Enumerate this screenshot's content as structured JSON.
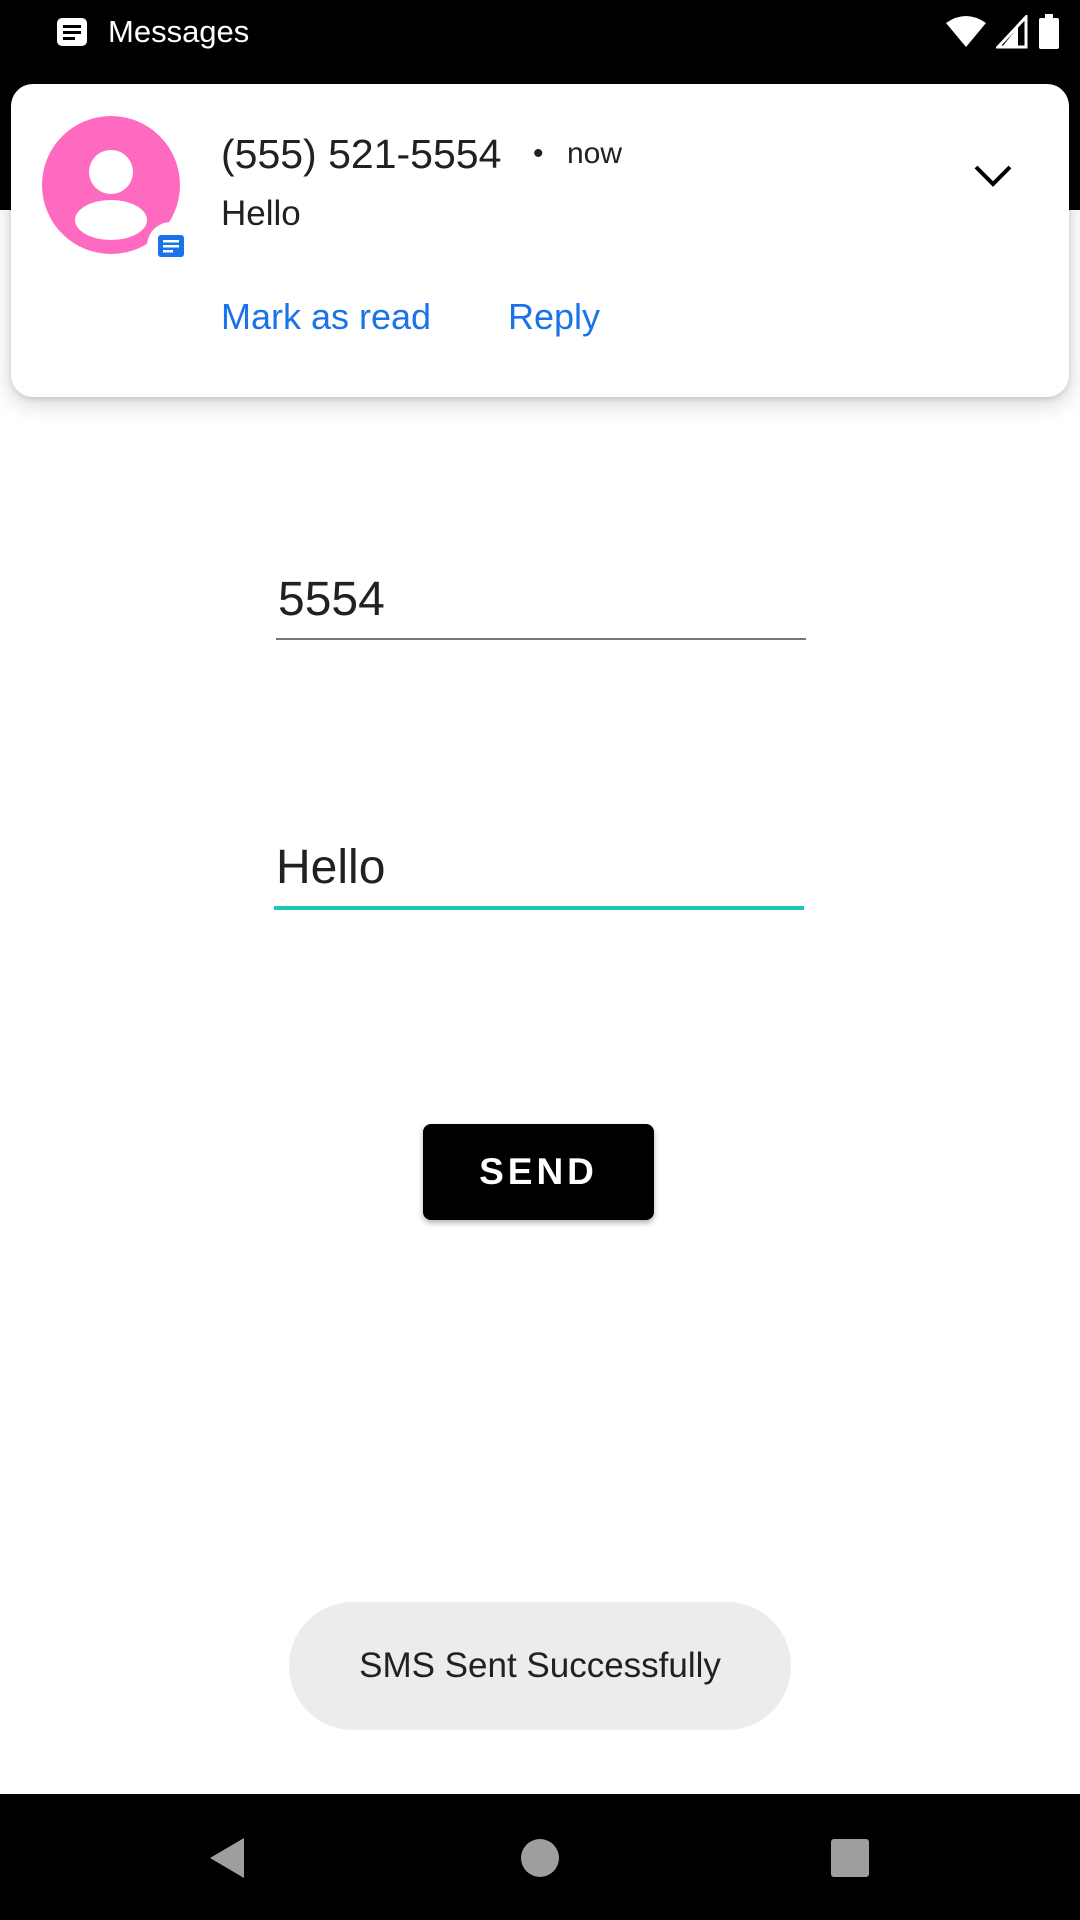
{
  "status_bar": {
    "app_name": "Messages",
    "icons": [
      "messages-icon",
      "wifi-icon",
      "signal-icon",
      "battery-icon"
    ]
  },
  "notification": {
    "sender": "(555) 521-5554",
    "separator": "•",
    "time": "now",
    "text": "Hello",
    "actions": {
      "mark_as_read": "Mark as read",
      "reply": "Reply"
    },
    "avatar_color": "#ff6ac1",
    "action_color": "#1a73e8"
  },
  "form": {
    "phone_value": "5554",
    "message_value": "Hello",
    "send_label": "SEND",
    "accent_color": "#1ec8b8"
  },
  "toast": {
    "text": "SMS Sent Successfully"
  },
  "nav_bar": {
    "icons": [
      "back-icon",
      "home-icon",
      "recents-icon"
    ]
  }
}
